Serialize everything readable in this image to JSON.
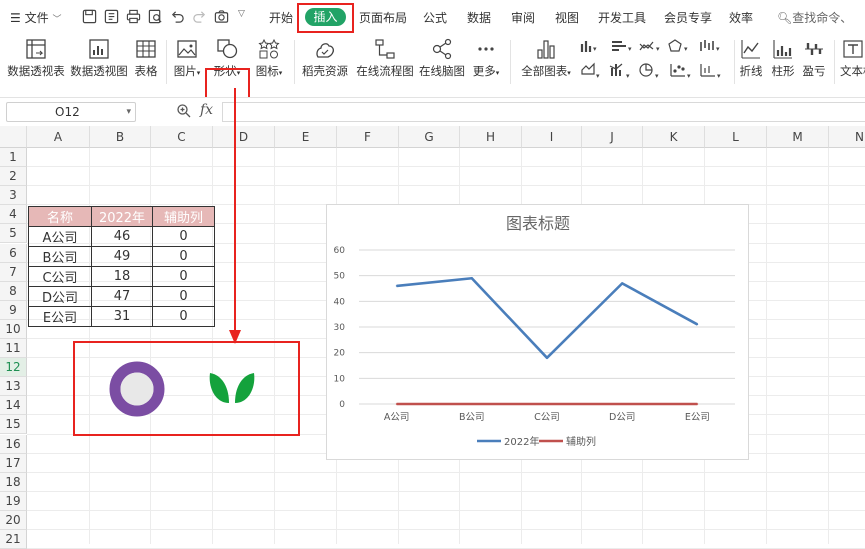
{
  "menubar": {
    "file_label": "文件",
    "tabs": [
      "开始",
      "插入",
      "页面布局",
      "公式",
      "数据",
      "审阅",
      "视图",
      "开发工具",
      "会员专享",
      "效率"
    ],
    "active_tab": "插入",
    "search_placeholder": "查找命令、"
  },
  "ribbon": {
    "buttons": [
      "数据透视表",
      "数据透视图",
      "表格",
      "图片",
      "形状",
      "图标",
      "稻壳资源",
      "在线流程图",
      "在线脑图",
      "更多",
      "全部图表",
      "折线",
      "柱形",
      "盈亏",
      "文本框"
    ]
  },
  "formula_bar": {
    "cell_ref": "O12",
    "fx": "fx"
  },
  "columns": [
    "A",
    "B",
    "C",
    "D",
    "E",
    "F",
    "G",
    "H",
    "I",
    "J",
    "K",
    "L",
    "M",
    "N"
  ],
  "rows": [
    "1",
    "2",
    "3",
    "4",
    "5",
    "6",
    "7",
    "8",
    "9",
    "10",
    "11",
    "12",
    "13",
    "14",
    "15",
    "16",
    "17",
    "18",
    "19",
    "20",
    "21"
  ],
  "selected_row": "12",
  "table": {
    "headers": [
      "名称",
      "2022年",
      "辅助列"
    ],
    "rows": [
      [
        "A公司",
        "46",
        "0"
      ],
      [
        "B公司",
        "49",
        "0"
      ],
      [
        "C公司",
        "18",
        "0"
      ],
      [
        "D公司",
        "47",
        "0"
      ],
      [
        "E公司",
        "31",
        "0"
      ]
    ]
  },
  "colors": {
    "accent": "#21a366",
    "highlight": "#e8231f",
    "header_fill": "#e6b8b7",
    "series1": "#4a7ebb",
    "series2": "#c0504d",
    "ring": "#7b4da3",
    "leaf": "#14a23c"
  },
  "chart_data": {
    "type": "line",
    "title": "图表标题",
    "categories": [
      "A公司",
      "B公司",
      "C公司",
      "D公司",
      "E公司"
    ],
    "series": [
      {
        "name": "2022年",
        "values": [
          46,
          49,
          18,
          47,
          31
        ],
        "color": "#4a7ebb"
      },
      {
        "name": "辅助列",
        "values": [
          0,
          0,
          0,
          0,
          0
        ],
        "color": "#c0504d"
      }
    ],
    "yticks": [
      "0",
      "10",
      "20",
      "30",
      "40",
      "50",
      "60"
    ],
    "ylim": [
      0,
      60
    ],
    "grid": true,
    "legend": "bottom"
  }
}
